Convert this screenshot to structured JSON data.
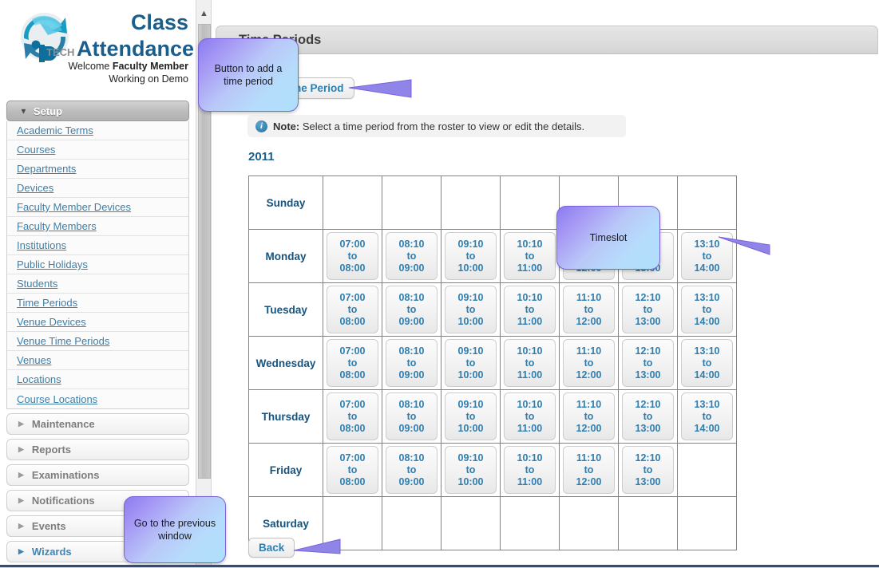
{
  "brand": {
    "logo_icon": "ip-tech-globe-logo",
    "logo_text": "iP TECH",
    "title_line1": "Class",
    "title_line2": "Attendance",
    "welcome_prefix": "Welcome ",
    "welcome_user": "Faculty Member",
    "welcome_line2": "Working on Demo",
    "accent_color": "#1b5e8c"
  },
  "sidebar": {
    "setup": {
      "label": "Setup",
      "expanded": true,
      "arrow_icon": "chevron-down-icon",
      "items": [
        {
          "label": "Academic Terms"
        },
        {
          "label": "Courses"
        },
        {
          "label": "Departments"
        },
        {
          "label": "Devices"
        },
        {
          "label": "Faculty Member Devices"
        },
        {
          "label": "Faculty Members"
        },
        {
          "label": "Institutions"
        },
        {
          "label": "Public Holidays"
        },
        {
          "label": "Students"
        },
        {
          "label": "Time Periods"
        },
        {
          "label": "Venue Devices"
        },
        {
          "label": "Venue Time Periods"
        },
        {
          "label": "Venues"
        },
        {
          "label": "Locations"
        },
        {
          "label": "Course Locations"
        }
      ]
    },
    "collapsed_sections": [
      {
        "label": "Maintenance",
        "arrow_icon": "chevron-right-icon",
        "highlighted": false
      },
      {
        "label": "Reports",
        "arrow_icon": "chevron-right-icon",
        "highlighted": false
      },
      {
        "label": "Examinations",
        "arrow_icon": "chevron-right-icon",
        "highlighted": false
      },
      {
        "label": "Notifications",
        "arrow_icon": "chevron-right-icon",
        "highlighted": false
      },
      {
        "label": "Events",
        "arrow_icon": "chevron-right-icon",
        "highlighted": false
      },
      {
        "label": "Wizards",
        "arrow_icon": "chevron-right-icon",
        "highlighted": true
      }
    ],
    "link_color": "#3d7fa8"
  },
  "scrollbar": {
    "up_icon": "chevron-up-icon",
    "down_icon": "chevron-down-icon"
  },
  "main": {
    "page_title": "Time Periods",
    "add_button_label": "Add Time Period",
    "note_icon": "info-icon",
    "note_label": "Note:",
    "note_text": " Select a time period from the roster to view or edit the details.",
    "year": "2011",
    "back_button_label": "Back"
  },
  "callouts": [
    {
      "name": "add-time-period-callout",
      "text": "Button to add a time period"
    },
    {
      "name": "timeslot-callout",
      "text": "Timeslot"
    },
    {
      "name": "back-button-callout",
      "text": "Go to the previous window"
    }
  ],
  "timetable": {
    "separator": "to",
    "rows": [
      {
        "day": "Sunday",
        "slots": [
          null,
          null,
          null,
          null,
          null,
          null,
          null
        ]
      },
      {
        "day": "Monday",
        "slots": [
          {
            "start": "07:00",
            "end": "08:00"
          },
          {
            "start": "08:10",
            "end": "09:00"
          },
          {
            "start": "09:10",
            "end": "10:00"
          },
          {
            "start": "10:10",
            "end": "11:00"
          },
          {
            "start": "11:10",
            "end": "12:00"
          },
          {
            "start": "12:10",
            "end": "13:00"
          },
          {
            "start": "13:10",
            "end": "14:00"
          }
        ]
      },
      {
        "day": "Tuesday",
        "slots": [
          {
            "start": "07:00",
            "end": "08:00"
          },
          {
            "start": "08:10",
            "end": "09:00"
          },
          {
            "start": "09:10",
            "end": "10:00"
          },
          {
            "start": "10:10",
            "end": "11:00"
          },
          {
            "start": "11:10",
            "end": "12:00"
          },
          {
            "start": "12:10",
            "end": "13:00"
          },
          {
            "start": "13:10",
            "end": "14:00"
          }
        ]
      },
      {
        "day": "Wednesday",
        "slots": [
          {
            "start": "07:00",
            "end": "08:00"
          },
          {
            "start": "08:10",
            "end": "09:00"
          },
          {
            "start": "09:10",
            "end": "10:00"
          },
          {
            "start": "10:10",
            "end": "11:00"
          },
          {
            "start": "11:10",
            "end": "12:00"
          },
          {
            "start": "12:10",
            "end": "13:00"
          },
          {
            "start": "13:10",
            "end": "14:00"
          }
        ]
      },
      {
        "day": "Thursday",
        "slots": [
          {
            "start": "07:00",
            "end": "08:00"
          },
          {
            "start": "08:10",
            "end": "09:00"
          },
          {
            "start": "09:10",
            "end": "10:00"
          },
          {
            "start": "10:10",
            "end": "11:00"
          },
          {
            "start": "11:10",
            "end": "12:00"
          },
          {
            "start": "12:10",
            "end": "13:00"
          },
          {
            "start": "13:10",
            "end": "14:00"
          }
        ]
      },
      {
        "day": "Friday",
        "slots": [
          {
            "start": "07:00",
            "end": "08:00"
          },
          {
            "start": "08:10",
            "end": "09:00"
          },
          {
            "start": "09:10",
            "end": "10:00"
          },
          {
            "start": "10:10",
            "end": "11:00"
          },
          {
            "start": "11:10",
            "end": "12:00"
          },
          {
            "start": "12:10",
            "end": "13:00"
          },
          null
        ]
      },
      {
        "day": "Saturday",
        "slots": [
          null,
          null,
          null,
          null,
          null,
          null,
          null
        ]
      }
    ]
  }
}
